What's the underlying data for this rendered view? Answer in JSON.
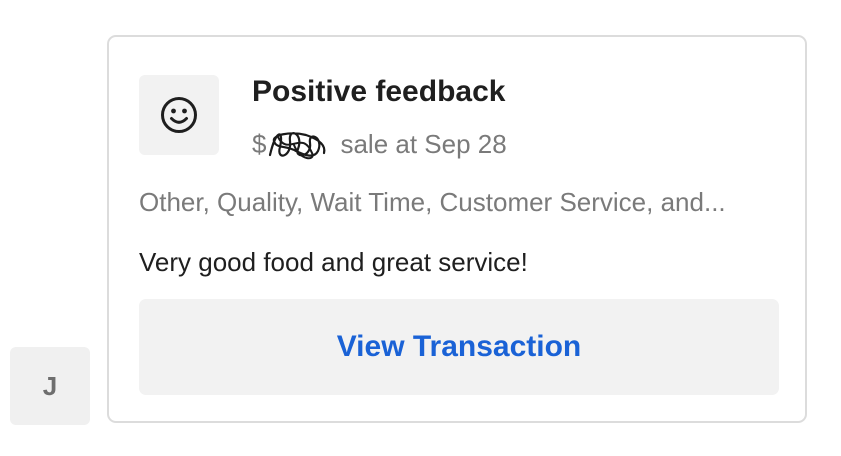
{
  "avatar": {
    "initial": "J"
  },
  "feedback_card": {
    "icon": "smiley-face-icon",
    "title": "Positive feedback",
    "subtitle_prefix": "$",
    "subtitle_suffix": "sale at Sep 28",
    "tags": "Other, Quality, Wait Time, Customer Service, and...",
    "comment": "Very good food and great service!",
    "button_label": "View Transaction"
  },
  "colors": {
    "accent": "#1a62d6",
    "title_text": "#1f1f1f",
    "muted_text": "#7a7a7a",
    "surface": "#f2f2f2",
    "border": "#dcdcdc"
  }
}
